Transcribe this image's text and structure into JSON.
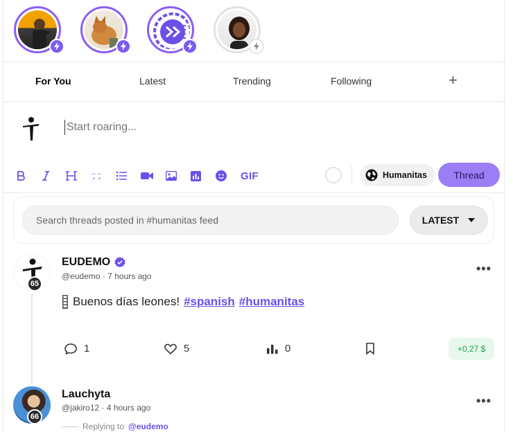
{
  "stories": [
    {
      "id": "story-1",
      "ring": "purple"
    },
    {
      "id": "story-2",
      "ring": "purple"
    },
    {
      "id": "story-3",
      "ring": "purple"
    },
    {
      "id": "story-4",
      "ring": "grey"
    }
  ],
  "tabs": {
    "for_you": "For You",
    "latest": "Latest",
    "trending": "Trending",
    "following": "Following",
    "add": "+"
  },
  "composer": {
    "placeholder": "Start roaring...",
    "gif_label": "GIF",
    "community": "Humanitas",
    "submit": "Thread"
  },
  "feed_search": {
    "placeholder": "Search threads posted in #humanitas feed",
    "sort": "LATEST"
  },
  "posts": [
    {
      "username": "EUDEMO",
      "verified": true,
      "level": "65",
      "handle": "@eudemo · 7 hours ago",
      "text": "Buenos días leones!",
      "tags": [
        "#spanish",
        "#humanitas"
      ],
      "comments": "1",
      "likes": "5",
      "views": "0",
      "earnings": "+0,27 $"
    },
    {
      "username": "Lauchyta",
      "level": "66",
      "handle": "@jakiro12 · 4 hours ago",
      "replying_label": "Replying to",
      "replying_to": "@eudemo"
    }
  ],
  "colors": {
    "accent": "#7c5cf0",
    "button": "#9b7df5",
    "earn_bg": "#e7f8ec",
    "earn_text": "#21a04a"
  }
}
